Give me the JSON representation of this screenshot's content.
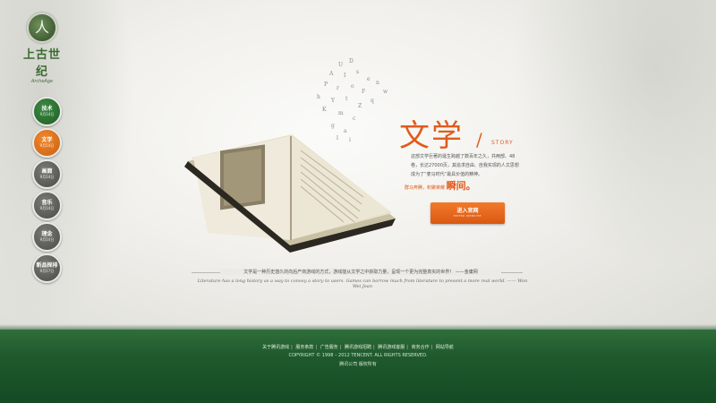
{
  "logo": {
    "emblem_glyph": "人",
    "name": "上古世纪",
    "subtitle": "ArcheAge"
  },
  "nav": [
    {
      "label": "技术",
      "date": "9月14日",
      "color": "green"
    },
    {
      "label": "文学",
      "date": "9月14日",
      "color": "orange"
    },
    {
      "label": "画面",
      "date": "9月14日",
      "color": "gray"
    },
    {
      "label": "音乐",
      "date": "9月14日",
      "color": "gray"
    },
    {
      "label": "理念",
      "date": "9月14日",
      "color": "gray"
    },
    {
      "label": "新品探排",
      "date": "9月17日",
      "color": "gray"
    }
  ],
  "content": {
    "title": "文学",
    "title_slash": "/",
    "title_en": "STORY",
    "description": "这部文学巨著的诞生跨越了数百年之久，共两部、48卷，长达27000页，其追求自由、自我实现的人文思想成为了“麦马时代”最具价值的精神。",
    "tagline_prefix": "群马奔腾，积聚荣耀",
    "tagline_emphasis": "瞬间。",
    "enter_button": {
      "label": "进入官网",
      "sub": "ENTER WEBSITE"
    }
  },
  "quote": {
    "cn": "文学是一种历史悠久的向后产商游戏的方式，游戏能从文学之中获取力量，呈现一个更为完整真实的世界！ ——金庸网",
    "en": "Literature has a long history as a way to convey a story to users. Games can borrow much from literature to present a more real world. —— Won Wei Jean"
  },
  "footer": {
    "links": [
      "关于腾讯游戏",
      "服务条款",
      "广告服务",
      "腾讯游戏招聘",
      "腾讯游戏客服",
      "商务合作",
      "网站导航"
    ],
    "copyright": "COPYRIGHT © 1998 – 2012 TENCENT. ALL RIGHTS RESERVED.",
    "company": "腾讯公司 版权所有"
  },
  "colors": {
    "accent": "#e05b1c",
    "green": "#1f5a2d",
    "nav_green": "#2f7a35",
    "nav_orange": "#e5741e",
    "nav_gray": "#5a5a56"
  }
}
